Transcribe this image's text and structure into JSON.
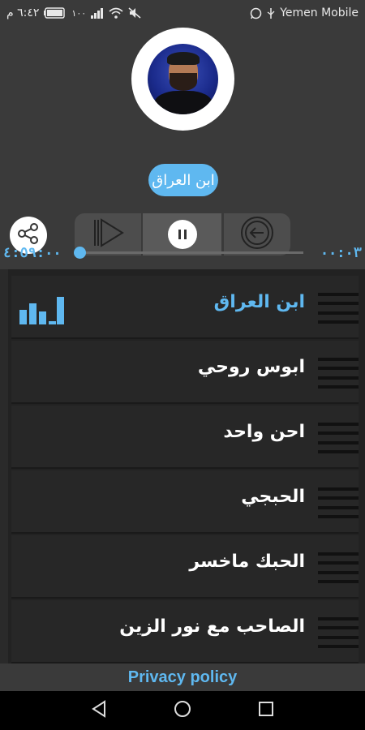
{
  "status_bar": {
    "time": "٦:٤٢ م",
    "battery": "١٠٠",
    "carrier": "Yemen Mobile",
    "icons_left": [
      "battery-icon",
      "signal-icon",
      "wifi-icon",
      "mute-icon"
    ],
    "icons_right": [
      "whatsapp-icon",
      "usb-icon"
    ]
  },
  "player": {
    "artist": "ابن العراق",
    "total_time": "٤:٥٩:٠٠",
    "current_time": "٠٠:٠٣",
    "progress": 0.0,
    "accent_color": "#5fb8f0",
    "controls": {
      "share": "share-icon",
      "next": "next-icon",
      "play_pause": "pause-icon",
      "prev": "previous-icon"
    }
  },
  "playlist": {
    "items": [
      {
        "title": "ابن العراق",
        "active": true
      },
      {
        "title": "ابوس روحي",
        "active": false
      },
      {
        "title": "احن واحد",
        "active": false
      },
      {
        "title": "الحبجي",
        "active": false
      },
      {
        "title": "الحبك ماخسر",
        "active": false
      },
      {
        "title": "الصاحب مع نور الزين",
        "active": false
      }
    ]
  },
  "footer": {
    "privacy_label": "Privacy policy"
  },
  "nav_bar": {
    "buttons": [
      "back-icon",
      "home-icon",
      "recents-icon"
    ]
  }
}
